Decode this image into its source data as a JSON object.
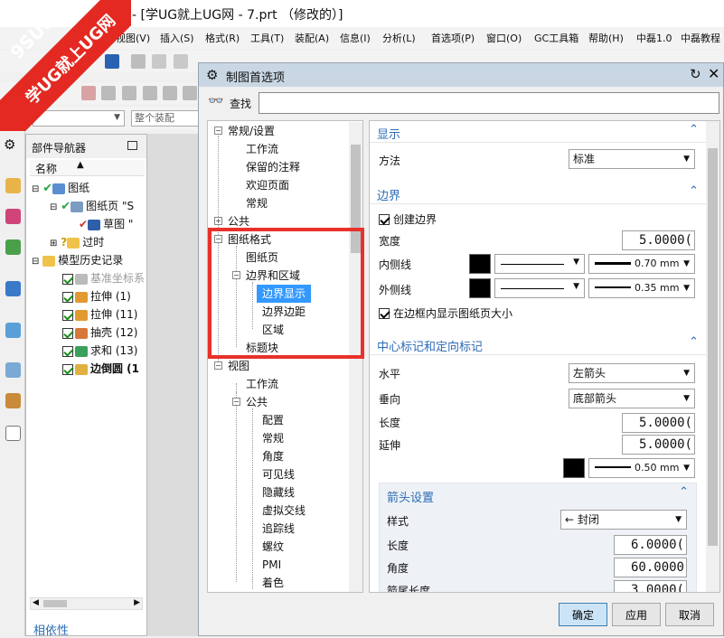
{
  "window": {
    "title": "- [学UG就上UG网 - 7.prt （修改的）]"
  },
  "watermark": {
    "line1": "9SUG",
    "line2": "学UG就上UG网"
  },
  "menu": [
    "视图(V)",
    "插入(S)",
    "格式(R)",
    "工具(T)",
    "装配(A)",
    "信息(I)",
    "分析(L)",
    "首选项(P)",
    "窗口(O)",
    "GC工具箱",
    "帮助(H)",
    "中磊1.0",
    "中磊教程"
  ],
  "toolbar": {
    "assembly_combo": "整个装配"
  },
  "part_navigator": {
    "title": "部件导航器",
    "column_name": "名称",
    "dependency": "相依性",
    "rows": [
      {
        "label": "图纸"
      },
      {
        "label": "图纸页 \"S"
      },
      {
        "label": "草图 \""
      },
      {
        "label": "过时"
      },
      {
        "label": "模型历史记录"
      },
      {
        "label": "基准坐标系"
      },
      {
        "label": "拉伸 (1)"
      },
      {
        "label": "拉伸 (11)"
      },
      {
        "label": "抽壳 (12)"
      },
      {
        "label": "求和 (13)"
      },
      {
        "label": "边倒圆 (1"
      }
    ]
  },
  "dialog": {
    "title": "制图首选项",
    "search_label": "查找",
    "search_value": "",
    "tree": [
      {
        "label": "常规/设置"
      },
      {
        "label": "工作流"
      },
      {
        "label": "保留的注释"
      },
      {
        "label": "欢迎页面"
      },
      {
        "label": "常规"
      },
      {
        "label": "公共"
      },
      {
        "label": "图纸格式"
      },
      {
        "label": "图纸页"
      },
      {
        "label": "边界和区域"
      },
      {
        "label": "边界显示"
      },
      {
        "label": "边界边距"
      },
      {
        "label": "区域"
      },
      {
        "label": "标题块"
      },
      {
        "label": "视图"
      },
      {
        "label": "工作流"
      },
      {
        "label": "公共"
      },
      {
        "label": "配置"
      },
      {
        "label": "常规"
      },
      {
        "label": "角度"
      },
      {
        "label": "可见线"
      },
      {
        "label": "隐藏线"
      },
      {
        "label": "虚拟交线"
      },
      {
        "label": "追踪线"
      },
      {
        "label": "螺纹"
      },
      {
        "label": "PMI"
      },
      {
        "label": "着色"
      }
    ],
    "display": {
      "header": "显示",
      "method_label": "方法",
      "method_value": "标准"
    },
    "border": {
      "header": "边界",
      "create_border": "创建边界",
      "width_label": "宽度",
      "width_value": "5.0000(",
      "inner_label": "内侧线",
      "inner_weight": "0.70 mm",
      "outer_label": "外侧线",
      "outer_weight": "0.35 mm",
      "show_size": "在边框内显示图纸页大小"
    },
    "center_marks": {
      "header": "中心标记和定向标记",
      "horizontal_label": "水平",
      "horizontal_value": "左箭头",
      "vertical_label": "垂向",
      "vertical_value": "底部箭头",
      "length_label": "长度",
      "length_value": "5.0000(",
      "extend_label": "延伸",
      "extend_value": "5.0000(",
      "weight": "0.50 mm"
    },
    "arrow": {
      "header": "箭头设置",
      "style_label": "样式",
      "style_value": "← 封闭",
      "length_label": "长度",
      "length_value": "6.0000(",
      "angle_label": "角度",
      "angle_value": "60.0000",
      "tail_label": "箭尾长度",
      "tail_value": "3.0000("
    },
    "buttons": {
      "ok": "确定",
      "apply": "应用",
      "cancel": "取消"
    }
  },
  "colors": {
    "accent": "#2d6bb5",
    "highlight": "#e8312a",
    "selection": "#3399ff"
  }
}
